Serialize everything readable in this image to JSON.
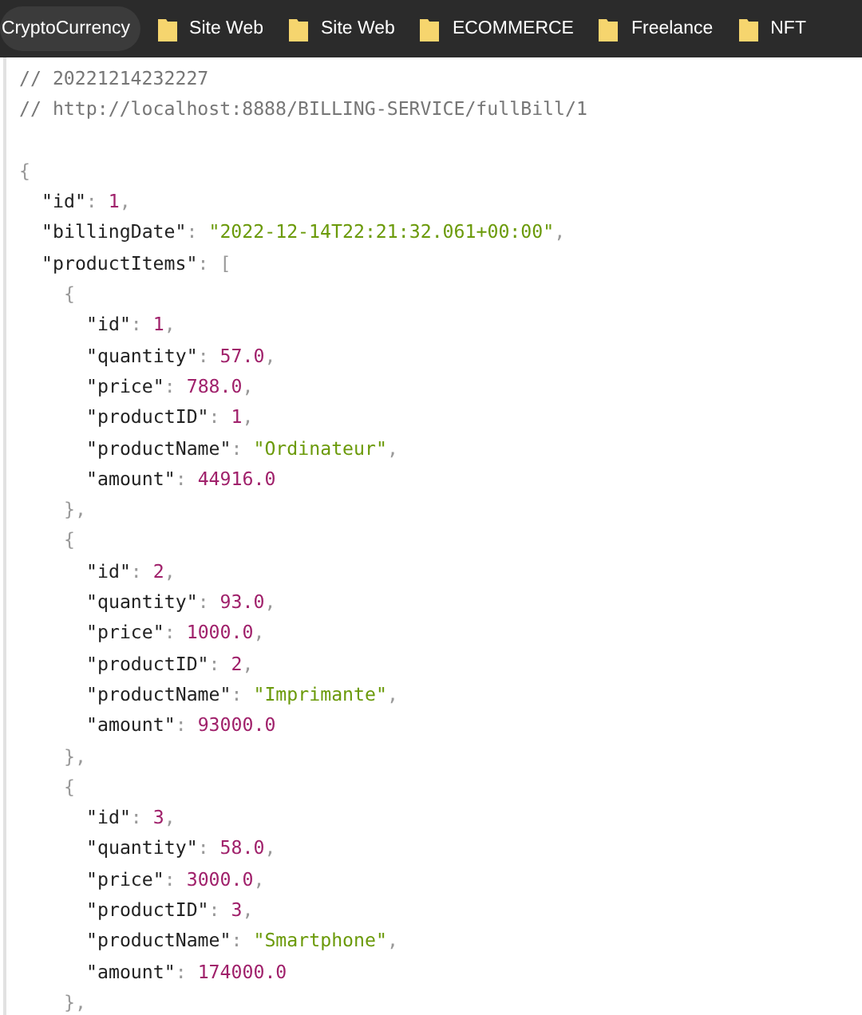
{
  "bookmarks_bar": {
    "items": [
      {
        "label": "CryptoCurrency",
        "kind": "chip"
      },
      {
        "label": "Site Web",
        "kind": "folder"
      },
      {
        "label": "Site Web",
        "kind": "folder"
      },
      {
        "label": "ECOMMERCE",
        "kind": "folder"
      },
      {
        "label": "Freelance",
        "kind": "folder"
      },
      {
        "label": "NFT",
        "kind": "folder"
      }
    ]
  },
  "viewer": {
    "comments": [
      "// 20221214232227",
      "// http://localhost:8888/BILLING-SERVICE/fullBill/1"
    ],
    "lines": [
      {
        "tokens": [
          {
            "text": "{",
            "kind": "punct"
          }
        ],
        "children": [
          {
            "tokens": [
              {
                "text": "\"id\"",
                "kind": "key"
              },
              {
                "text": ": ",
                "kind": "punct"
              },
              {
                "text": "1",
                "kind": "number"
              },
              {
                "text": ",",
                "kind": "punct"
              }
            ]
          },
          {
            "tokens": [
              {
                "text": "\"billingDate\"",
                "kind": "key"
              },
              {
                "text": ": ",
                "kind": "punct"
              },
              {
                "text": "\"2022-12-14T22:21:32.061+00:00\"",
                "kind": "string"
              },
              {
                "text": ",",
                "kind": "punct"
              }
            ]
          },
          {
            "tokens": [
              {
                "text": "\"productItems\"",
                "kind": "key"
              },
              {
                "text": ": [",
                "kind": "punct"
              }
            ],
            "children": [
              {
                "tokens": [
                  {
                    "text": "{",
                    "kind": "punct"
                  }
                ],
                "children": [
                  {
                    "tokens": [
                      {
                        "text": "\"id\"",
                        "kind": "key"
                      },
                      {
                        "text": ": ",
                        "kind": "punct"
                      },
                      {
                        "text": "1",
                        "kind": "number"
                      },
                      {
                        "text": ",",
                        "kind": "punct"
                      }
                    ]
                  },
                  {
                    "tokens": [
                      {
                        "text": "\"quantity\"",
                        "kind": "key"
                      },
                      {
                        "text": ": ",
                        "kind": "punct"
                      },
                      {
                        "text": "57.0",
                        "kind": "number"
                      },
                      {
                        "text": ",",
                        "kind": "punct"
                      }
                    ]
                  },
                  {
                    "tokens": [
                      {
                        "text": "\"price\"",
                        "kind": "key"
                      },
                      {
                        "text": ": ",
                        "kind": "punct"
                      },
                      {
                        "text": "788.0",
                        "kind": "number"
                      },
                      {
                        "text": ",",
                        "kind": "punct"
                      }
                    ]
                  },
                  {
                    "tokens": [
                      {
                        "text": "\"productID\"",
                        "kind": "key"
                      },
                      {
                        "text": ": ",
                        "kind": "punct"
                      },
                      {
                        "text": "1",
                        "kind": "number"
                      },
                      {
                        "text": ",",
                        "kind": "punct"
                      }
                    ]
                  },
                  {
                    "tokens": [
                      {
                        "text": "\"productName\"",
                        "kind": "key"
                      },
                      {
                        "text": ": ",
                        "kind": "punct"
                      },
                      {
                        "text": "\"Ordinateur\"",
                        "kind": "string"
                      },
                      {
                        "text": ",",
                        "kind": "punct"
                      }
                    ]
                  },
                  {
                    "tokens": [
                      {
                        "text": "\"amount\"",
                        "kind": "key"
                      },
                      {
                        "text": ": ",
                        "kind": "punct"
                      },
                      {
                        "text": "44916.0",
                        "kind": "number"
                      }
                    ]
                  }
                ]
              },
              {
                "tokens": [
                  {
                    "text": "},",
                    "kind": "punct"
                  }
                ]
              },
              {
                "tokens": [
                  {
                    "text": "{",
                    "kind": "punct"
                  }
                ],
                "children": [
                  {
                    "tokens": [
                      {
                        "text": "\"id\"",
                        "kind": "key"
                      },
                      {
                        "text": ": ",
                        "kind": "punct"
                      },
                      {
                        "text": "2",
                        "kind": "number"
                      },
                      {
                        "text": ",",
                        "kind": "punct"
                      }
                    ]
                  },
                  {
                    "tokens": [
                      {
                        "text": "\"quantity\"",
                        "kind": "key"
                      },
                      {
                        "text": ": ",
                        "kind": "punct"
                      },
                      {
                        "text": "93.0",
                        "kind": "number"
                      },
                      {
                        "text": ",",
                        "kind": "punct"
                      }
                    ]
                  },
                  {
                    "tokens": [
                      {
                        "text": "\"price\"",
                        "kind": "key"
                      },
                      {
                        "text": ": ",
                        "kind": "punct"
                      },
                      {
                        "text": "1000.0",
                        "kind": "number"
                      },
                      {
                        "text": ",",
                        "kind": "punct"
                      }
                    ]
                  },
                  {
                    "tokens": [
                      {
                        "text": "\"productID\"",
                        "kind": "key"
                      },
                      {
                        "text": ": ",
                        "kind": "punct"
                      },
                      {
                        "text": "2",
                        "kind": "number"
                      },
                      {
                        "text": ",",
                        "kind": "punct"
                      }
                    ]
                  },
                  {
                    "tokens": [
                      {
                        "text": "\"productName\"",
                        "kind": "key"
                      },
                      {
                        "text": ": ",
                        "kind": "punct"
                      },
                      {
                        "text": "\"Imprimante\"",
                        "kind": "string"
                      },
                      {
                        "text": ",",
                        "kind": "punct"
                      }
                    ]
                  },
                  {
                    "tokens": [
                      {
                        "text": "\"amount\"",
                        "kind": "key"
                      },
                      {
                        "text": ": ",
                        "kind": "punct"
                      },
                      {
                        "text": "93000.0",
                        "kind": "number"
                      }
                    ]
                  }
                ]
              },
              {
                "tokens": [
                  {
                    "text": "},",
                    "kind": "punct"
                  }
                ]
              },
              {
                "tokens": [
                  {
                    "text": "{",
                    "kind": "punct"
                  }
                ],
                "children": [
                  {
                    "tokens": [
                      {
                        "text": "\"id\"",
                        "kind": "key"
                      },
                      {
                        "text": ": ",
                        "kind": "punct"
                      },
                      {
                        "text": "3",
                        "kind": "number"
                      },
                      {
                        "text": ",",
                        "kind": "punct"
                      }
                    ]
                  },
                  {
                    "tokens": [
                      {
                        "text": "\"quantity\"",
                        "kind": "key"
                      },
                      {
                        "text": ": ",
                        "kind": "punct"
                      },
                      {
                        "text": "58.0",
                        "kind": "number"
                      },
                      {
                        "text": ",",
                        "kind": "punct"
                      }
                    ]
                  },
                  {
                    "tokens": [
                      {
                        "text": "\"price\"",
                        "kind": "key"
                      },
                      {
                        "text": ": ",
                        "kind": "punct"
                      },
                      {
                        "text": "3000.0",
                        "kind": "number"
                      },
                      {
                        "text": ",",
                        "kind": "punct"
                      }
                    ]
                  },
                  {
                    "tokens": [
                      {
                        "text": "\"productID\"",
                        "kind": "key"
                      },
                      {
                        "text": ": ",
                        "kind": "punct"
                      },
                      {
                        "text": "3",
                        "kind": "number"
                      },
                      {
                        "text": ",",
                        "kind": "punct"
                      }
                    ]
                  },
                  {
                    "tokens": [
                      {
                        "text": "\"productName\"",
                        "kind": "key"
                      },
                      {
                        "text": ": ",
                        "kind": "punct"
                      },
                      {
                        "text": "\"Smartphone\"",
                        "kind": "string"
                      },
                      {
                        "text": ",",
                        "kind": "punct"
                      }
                    ]
                  },
                  {
                    "tokens": [
                      {
                        "text": "\"amount\"",
                        "kind": "key"
                      },
                      {
                        "text": ": ",
                        "kind": "punct"
                      },
                      {
                        "text": "174000.0",
                        "kind": "number"
                      }
                    ]
                  }
                ]
              },
              {
                "tokens": [
                  {
                    "text": "},",
                    "kind": "punct"
                  }
                ]
              }
            ]
          }
        ]
      }
    ]
  }
}
